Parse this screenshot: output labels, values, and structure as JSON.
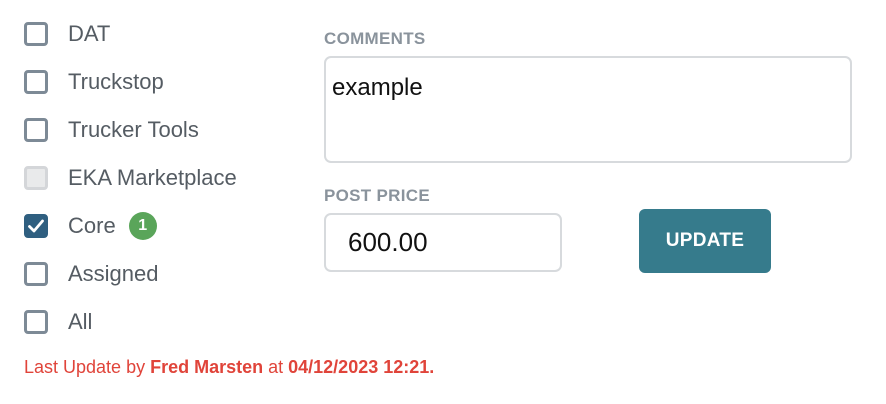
{
  "boards": [
    {
      "label": "DAT",
      "checked": false,
      "disabled": false
    },
    {
      "label": "Truckstop",
      "checked": false,
      "disabled": false
    },
    {
      "label": "Trucker Tools",
      "checked": false,
      "disabled": false
    },
    {
      "label": "EKA Marketplace",
      "checked": false,
      "disabled": true
    },
    {
      "label": "Core",
      "checked": true,
      "disabled": false,
      "badge": "1"
    },
    {
      "label": "Assigned",
      "checked": false,
      "disabled": false
    },
    {
      "label": "All",
      "checked": false,
      "disabled": false
    }
  ],
  "comments": {
    "label": "COMMENTS",
    "value": "example"
  },
  "post_price": {
    "label": "POST PRICE",
    "value": "600.00"
  },
  "update_button": {
    "label": "UPDATE"
  },
  "last_update": {
    "prefix": "Last Update by ",
    "user": "Fred Marsten",
    "middle": " at ",
    "datetime": "04/12/2023 12:21",
    "suffix": "."
  },
  "colors": {
    "accent": "#367b8c",
    "checkbox_checked": "#2f5f80",
    "checkbox_border": "#7d8a96",
    "badge": "#5aa55a",
    "warning_text": "#e0443a"
  }
}
